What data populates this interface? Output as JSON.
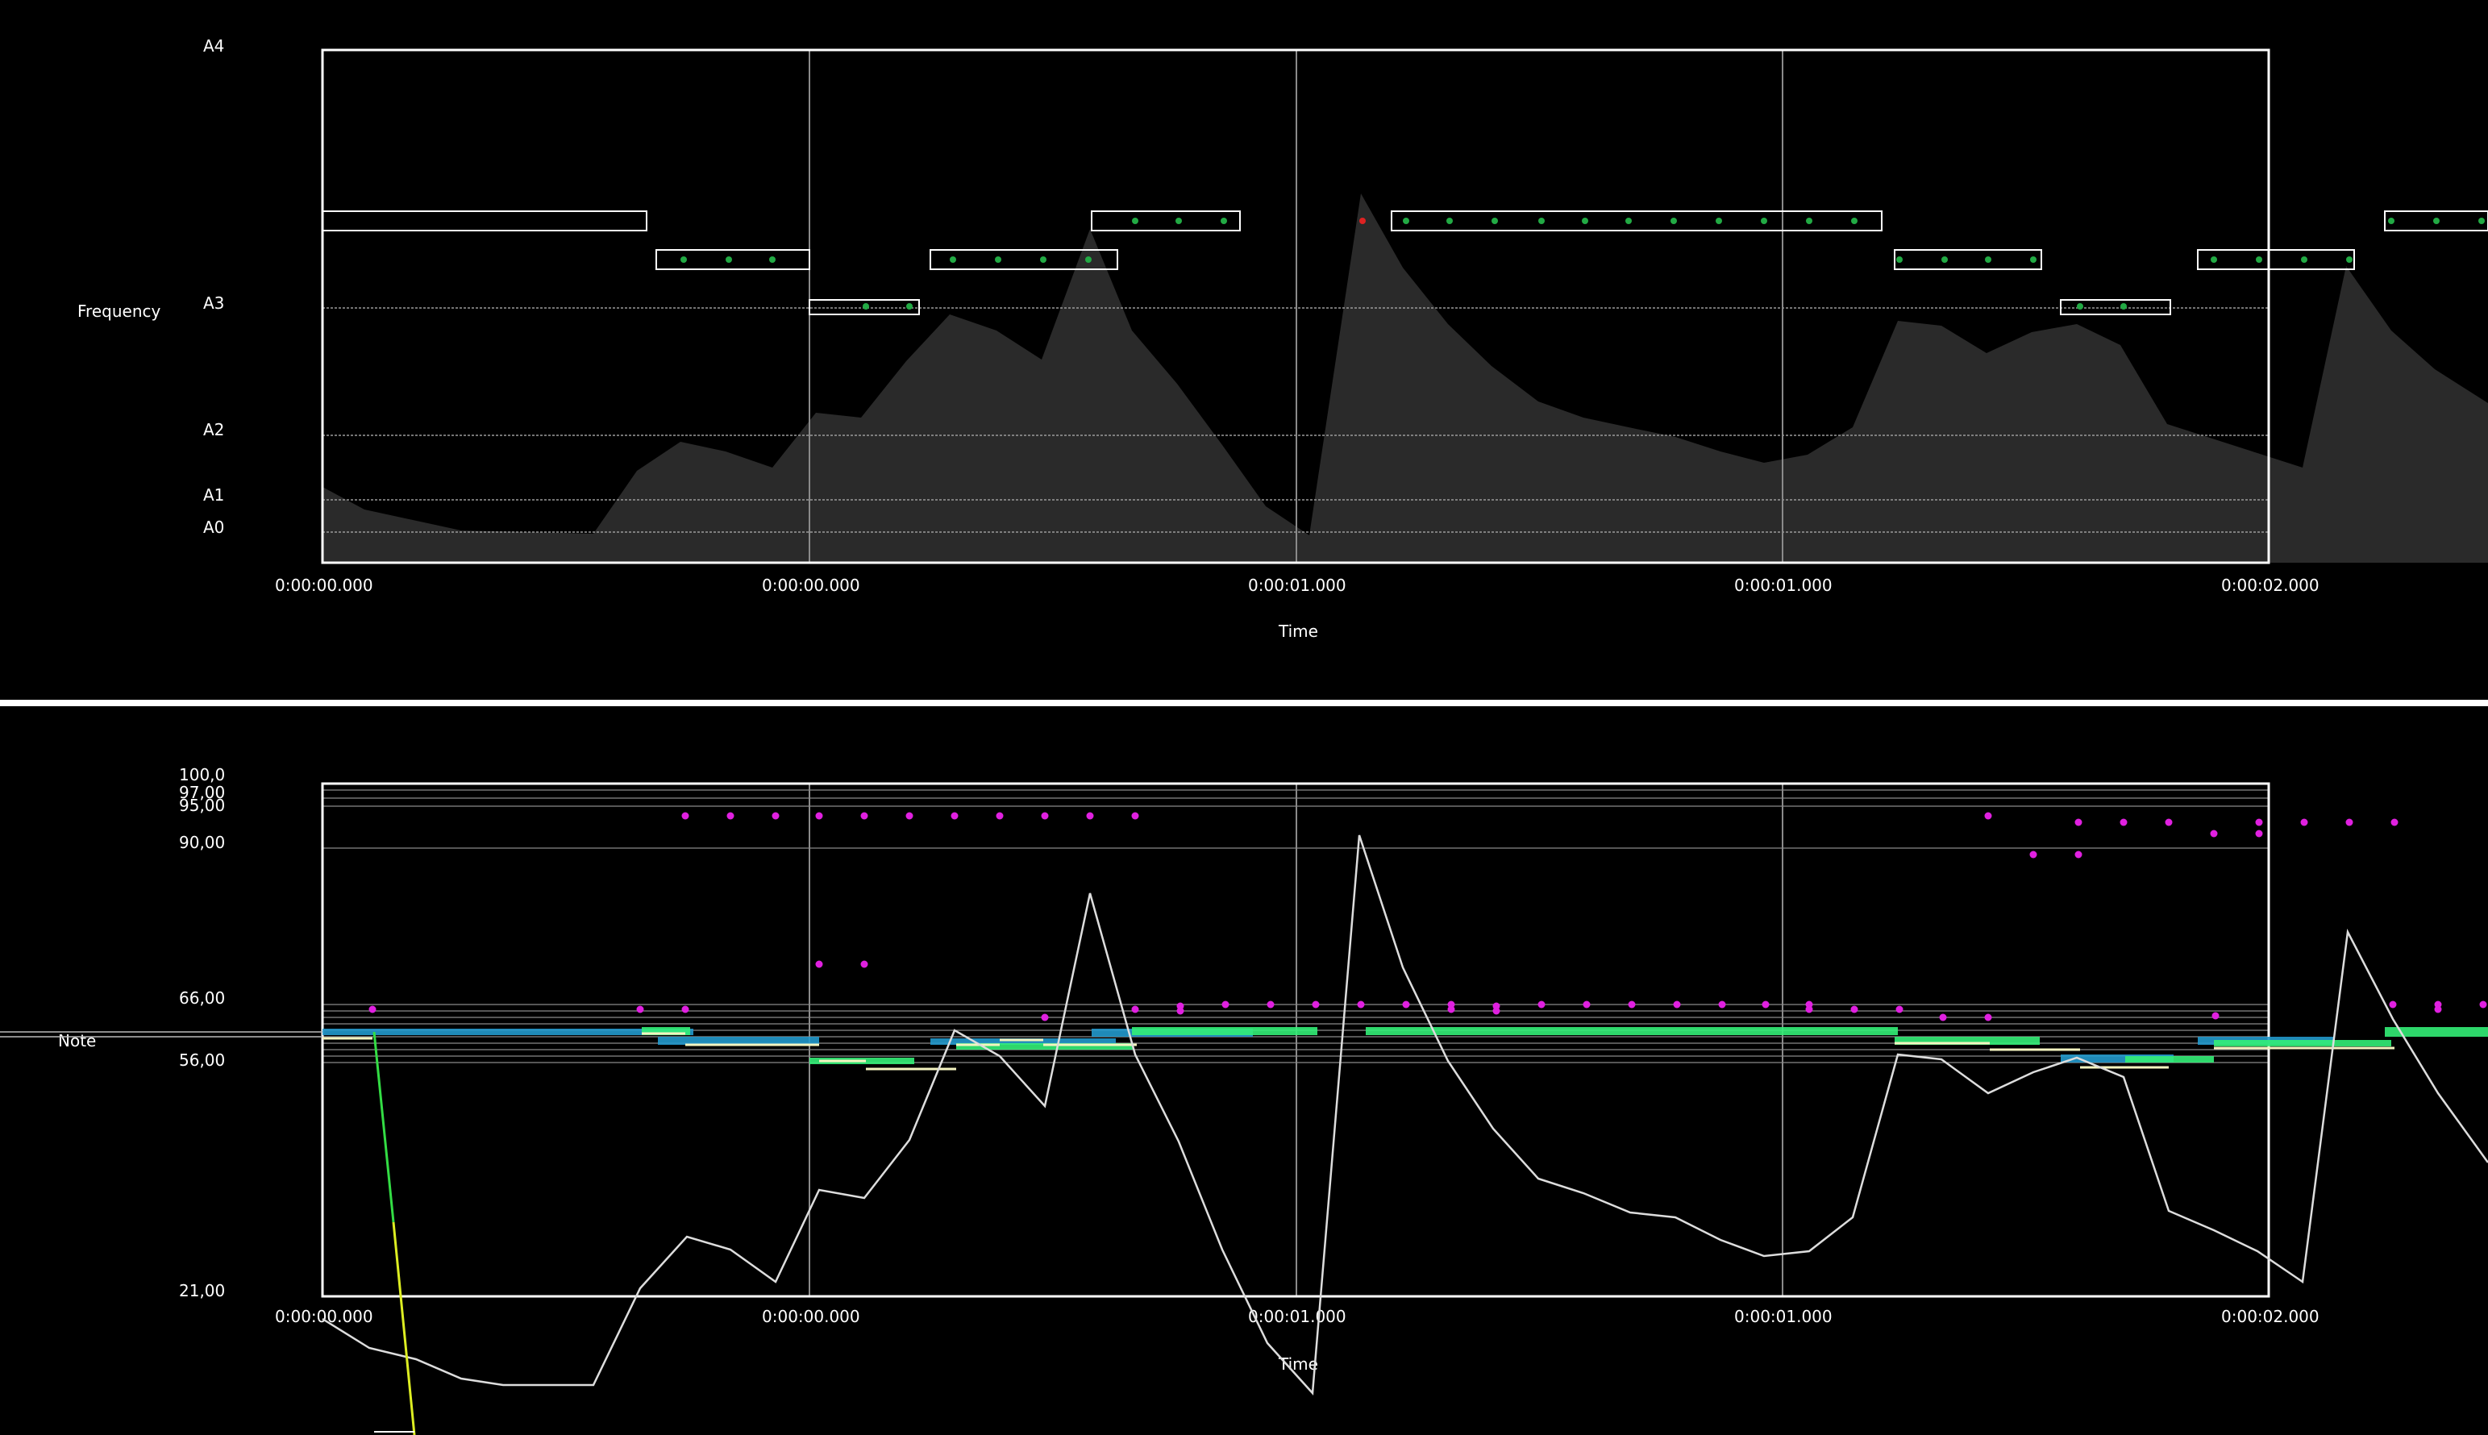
{
  "top_panel": {
    "ylabel": "Frequency",
    "xlabel": "Time",
    "y_ticks": [
      "A4",
      "A3",
      "A2",
      "A1",
      "A0"
    ],
    "x_ticks": [
      "0:00:00.000",
      "0:00:00.000",
      "0:00:01.000",
      "0:00:01.000",
      "0:00:02.000"
    ]
  },
  "bottom_panel": {
    "ylabel": "Note",
    "xlabel": "Time",
    "y_ticks": [
      "100,0",
      "97,00",
      "95,00",
      "90,00",
      "66,00",
      "56,00",
      "21,00"
    ],
    "x_ticks": [
      "0:00:00.000",
      "0:00:00.000",
      "0:00:01.000",
      "0:00:01.000",
      "0:00:02.000"
    ]
  },
  "colors": {
    "background": "#000000",
    "frame": "#ffffff",
    "envelope_fill": "#2a2a2a",
    "pitch_line": "#dddddd",
    "dots_green": "#22aa44",
    "dots_red": "#dd2222",
    "dots_magenta": "#e020e0",
    "note_bars": "#33ee77",
    "note_bars_alt": "#2299cc",
    "yellow_line": "#ddee22"
  }
}
